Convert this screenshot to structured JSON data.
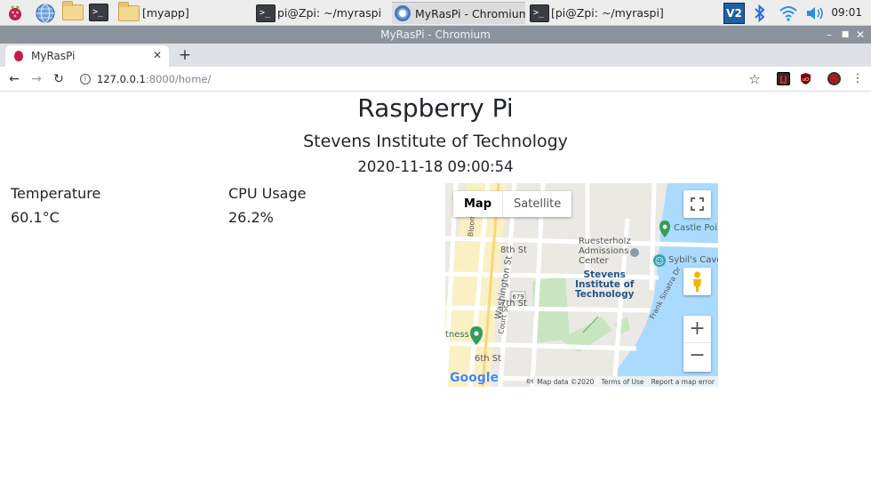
{
  "taskbar": {
    "tasks": [
      {
        "label": "[myapp]"
      },
      {
        "label": "pi@Zpi: ~/myraspi"
      },
      {
        "label": "MyRasPi - Chromium"
      },
      {
        "label": "[pi@Zpi: ~/myraspi]"
      }
    ],
    "clock": "09:01"
  },
  "window": {
    "title": "MyRasPi - Chromium"
  },
  "browser": {
    "tab_title": "MyRasPi",
    "url_host": "127.0.0.1",
    "url_rest": ":8000/home/"
  },
  "page": {
    "title": "Raspberry Pi",
    "subtitle": "Stevens Institute of Technology",
    "datetime": "2020-11-18 09:00:54",
    "temperature_label": "Temperature",
    "temperature_value": "60.1°C",
    "cpu_label": "CPU Usage",
    "cpu_value": "26.2%"
  },
  "map": {
    "map_button": "Map",
    "satellite_button": "Satellite",
    "labels": {
      "ruesterholz": "Ruesterholz\nAdmissions\nCenter",
      "stevens": "Stevens\nInstitute of\nTechnology",
      "castle": "Castle Poi",
      "sybils": "Sybil's Cave",
      "fitness": "tness",
      "street_8th": "8th St",
      "street_7th": "7th St",
      "street_6th": "6th St",
      "washington": "Washington St",
      "court": "Court St",
      "bloom": "Bloom",
      "frank": "Frank Sinatra Dr",
      "route": "679",
      "eet": "eet"
    },
    "logo": "Google",
    "map_data": "Map data ©2020",
    "terms": "Terms of Use",
    "report": "Report a map error"
  }
}
